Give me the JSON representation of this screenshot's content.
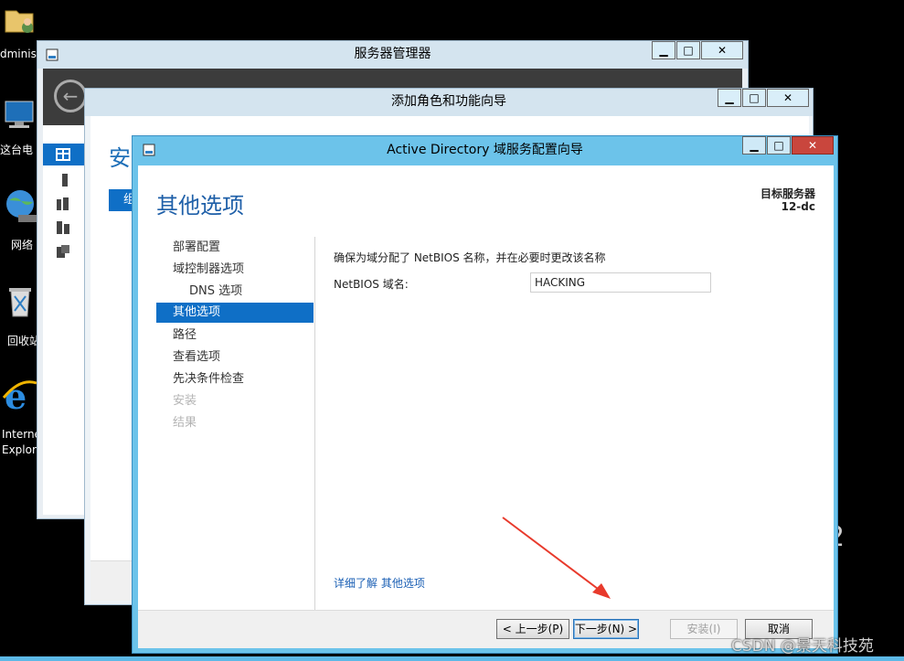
{
  "desktop": {
    "icons": [
      {
        "label": "dminist"
      },
      {
        "label": "这台电"
      },
      {
        "label": "网络"
      },
      {
        "label": "回收站"
      },
      {
        "label": "Interne"
      },
      {
        "label": "Explor"
      }
    ]
  },
  "server_manager": {
    "title": "服务器管理器",
    "side_text": "安",
    "blue_text": "组"
  },
  "add_roles": {
    "title": "添加角色和功能向导"
  },
  "wizard": {
    "title": "Active Directory 域服务配置向导",
    "page_title": "其他选项",
    "target_label": "目标服务器",
    "target_value": "12-dc",
    "nav": [
      {
        "label": "部署配置"
      },
      {
        "label": "域控制器选项"
      },
      {
        "label": "DNS 选项"
      },
      {
        "label": "其他选项"
      },
      {
        "label": "路径"
      },
      {
        "label": "查看选项"
      },
      {
        "label": "先决条件检查"
      },
      {
        "label": "安装"
      },
      {
        "label": "结果"
      }
    ],
    "description": "确保为域分配了 NetBIOS 名称，并在必要时更改该名称",
    "netbios_label": "NetBIOS 域名:",
    "netbios_value": "HACKING",
    "link_prefix": "详细了解",
    "link_text": "其他选项",
    "buttons": {
      "back": "< 上一步(P)",
      "next": "下一步(N) >",
      "install": "安装(I)",
      "cancel": "取消"
    }
  },
  "watermark": "CSDN @景天科技苑",
  "bg_digit": "2",
  "colors": {
    "accent": "#0f6fc6",
    "title_bar": "#6cc3ea",
    "close": "#c9463d",
    "link": "#1a5fb4"
  }
}
